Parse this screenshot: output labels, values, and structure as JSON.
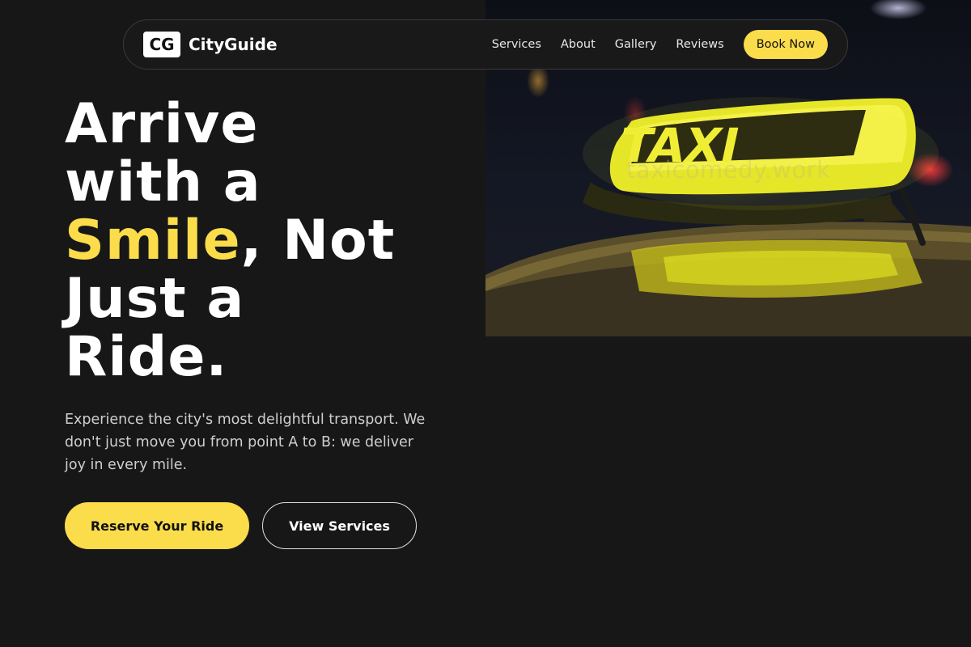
{
  "brand": {
    "logo_text": "CG",
    "name": "CityGuide"
  },
  "nav": {
    "links": [
      "Services",
      "About",
      "Gallery",
      "Reviews"
    ],
    "cta_label": "Book Now"
  },
  "hero": {
    "title_line1": "Arrive",
    "title_line2": "with a",
    "title_accent": "Smile",
    "title_after_accent": ", Not",
    "title_line4": "Just a",
    "title_line5": "Ride.",
    "subtitle": "Experience the city's most delightful transport. We don't just move you from point A to B: we deliver joy in every mile.",
    "primary_button": "Reserve Your Ride",
    "secondary_button": "View Services",
    "image_sign_text": "TAXI",
    "image_watermark": "taxicomedy.work"
  },
  "colors": {
    "background": "#171717",
    "accent": "#fbdc4a",
    "text": "#ffffff",
    "muted_text": "#cfcfcf"
  }
}
